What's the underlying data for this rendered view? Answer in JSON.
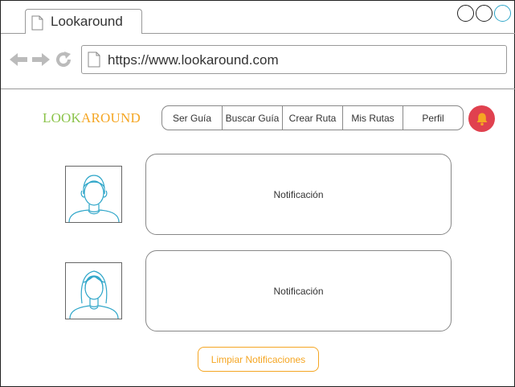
{
  "browser": {
    "tab_title": "Lookaround",
    "url": "https://www.lookaround.com"
  },
  "app": {
    "logo_part1": "LOOK",
    "logo_part2": "AROUND",
    "colors": {
      "logo_green": "#8bc34a",
      "accent_orange": "#f5a623",
      "bell_red": "#e0414f",
      "avatar_stroke": "#2fa6c9"
    }
  },
  "menu": {
    "items": [
      {
        "label": "Ser Guía"
      },
      {
        "label": "Buscar Guía"
      },
      {
        "label": "Crear Ruta"
      },
      {
        "label": "Mis Rutas"
      },
      {
        "label": "Perfil"
      }
    ]
  },
  "notifications": [
    {
      "text": "Notificación",
      "avatar": "male-user-icon"
    },
    {
      "text": "Notificación",
      "avatar": "female-user-icon"
    }
  ],
  "actions": {
    "clear_label": "Limpiar Notificaciones"
  },
  "icons": {
    "tab": "page-icon",
    "back": "back-arrow-icon",
    "forward": "forward-arrow-icon",
    "reload": "reload-icon",
    "address": "page-icon",
    "bell": "bell-icon"
  }
}
